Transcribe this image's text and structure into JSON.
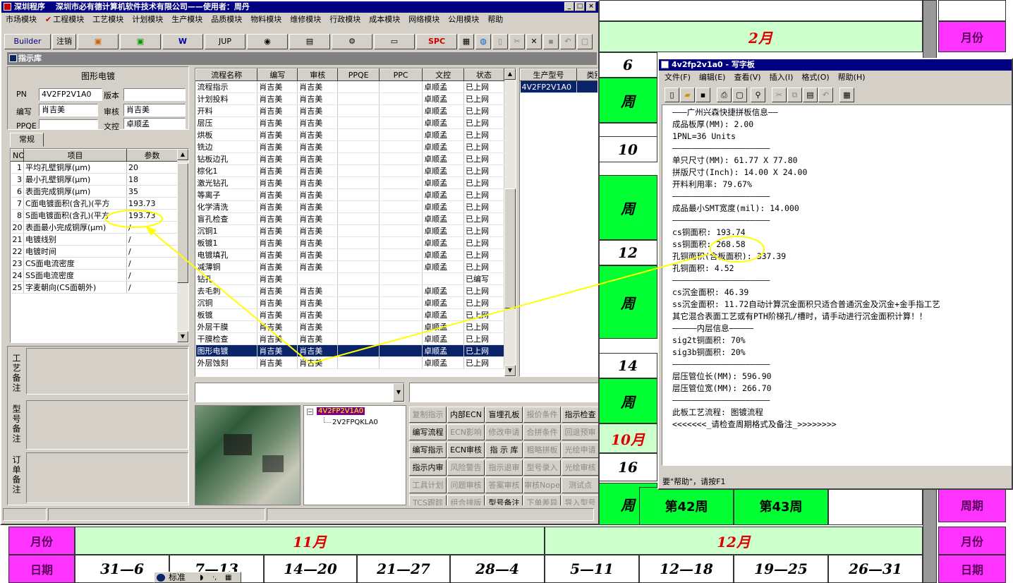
{
  "background_calendar": {
    "colors": {
      "green": "#00ff33",
      "magenta": "#ff33ff",
      "light_green": "#ccffcc",
      "red_text": "#e00000"
    },
    "top_month": "2月",
    "side_label_month": "月份",
    "side_label_period": "周期",
    "side_label_date": "日期",
    "left_numbers": [
      "6",
      "10",
      "12",
      "14",
      "16"
    ],
    "left_weeks": [
      "周",
      "周",
      "周",
      "周",
      "周"
    ],
    "month_10": "10月",
    "week_42": "第42周",
    "week_43": "第43周",
    "bottom_month_label": "月份",
    "bottom_date_label": "日期",
    "month_11": "11月",
    "month_12": "12月",
    "date_ranges": [
      "31—6",
      "7—13",
      "14—20",
      "21—27",
      "28—4",
      "5—11",
      "12—18",
      "19—25",
      "26—31"
    ]
  },
  "main_window": {
    "title": "深圳程序　 深圳市必有德计算机软件技术有限公司——使用者：周丹",
    "menu": [
      "市场模块",
      "工程模块",
      "工艺模块",
      "计划模块",
      "生产模块",
      "品质模块",
      "物料模块",
      "维修模块",
      "行政模块",
      "成本模块",
      "网络模块",
      "公用模块",
      "帮助"
    ],
    "toolbar": {
      "builder": "Builder",
      "logout": "注销",
      "jup": "JUP",
      "spc": "SPC"
    },
    "subtitle": "指示库",
    "form": {
      "heading": "图形电镀",
      "pn_label": "PN",
      "pn_value": "4V2FP2V1A0",
      "version_label": "版本",
      "version_value": "",
      "writer_label": "编写",
      "writer_value": "肖吉美",
      "audit_label": "审核",
      "audit_value": "肖吉美",
      "ppqe_label": "PPQE",
      "ppqe_value": "",
      "control_label": "文控",
      "control_value": "卓顺孟",
      "tab_general": "常规"
    },
    "param_table": {
      "headers": [
        "NO",
        "项目",
        "参数"
      ],
      "rows": [
        [
          "1",
          "平均孔壁铜厚(μm)",
          "20"
        ],
        [
          "3",
          "最小孔壁铜厚(μm)",
          "18"
        ],
        [
          "6",
          "表面完成铜厚(μm)",
          "35"
        ],
        [
          "7",
          "C面电镀面积(含孔)(平方",
          "193.73"
        ],
        [
          "8",
          "S面电镀面积(含孔)(平方",
          "193.73"
        ],
        [
          "20",
          "表面最小完成铜厚(μm)",
          "/"
        ],
        [
          "21",
          "电镀线别",
          "/"
        ],
        [
          "22",
          "电镀时间",
          "/"
        ],
        [
          "23",
          "CS面电流密度",
          "/"
        ],
        [
          "24",
          "SS面电流密度",
          "/"
        ],
        [
          "25",
          "字麦朝向(CS面朝外)",
          "/"
        ]
      ]
    },
    "remarks": {
      "process": "工艺备注",
      "model": "型号备注",
      "order": "订单备注"
    },
    "process_table": {
      "headers": [
        "流程名称",
        "编写",
        "审核",
        "PPQE",
        "PPC",
        "文控",
        "状态"
      ],
      "rows": [
        [
          "流程指示",
          "肖吉美",
          "肖吉美",
          "",
          "",
          "卓顺孟",
          "已上网"
        ],
        [
          "计划投料",
          "肖吉美",
          "肖吉美",
          "",
          "",
          "卓顺孟",
          "已上网"
        ],
        [
          "开料",
          "肖吉美",
          "肖吉美",
          "",
          "",
          "卓顺孟",
          "已上网"
        ],
        [
          "层压",
          "肖吉美",
          "肖吉美",
          "",
          "",
          "卓顺孟",
          "已上网"
        ],
        [
          "烘板",
          "肖吉美",
          "肖吉美",
          "",
          "",
          "卓顺孟",
          "已上网"
        ],
        [
          "铣边",
          "肖吉美",
          "肖吉美",
          "",
          "",
          "卓顺孟",
          "已上网"
        ],
        [
          "钻板边孔",
          "肖吉美",
          "肖吉美",
          "",
          "",
          "卓顺孟",
          "已上网"
        ],
        [
          "棕化1",
          "肖吉美",
          "肖吉美",
          "",
          "",
          "卓顺孟",
          "已上网"
        ],
        [
          "激光钻孔",
          "肖吉美",
          "肖吉美",
          "",
          "",
          "卓顺孟",
          "已上网"
        ],
        [
          "等离子",
          "肖吉美",
          "肖吉美",
          "",
          "",
          "卓顺孟",
          "已上网"
        ],
        [
          "化学清洗",
          "肖吉美",
          "肖吉美",
          "",
          "",
          "卓顺孟",
          "已上网"
        ],
        [
          "盲孔检查",
          "肖吉美",
          "肖吉美",
          "",
          "",
          "卓顺孟",
          "已上网"
        ],
        [
          "沉铜1",
          "肖吉美",
          "肖吉美",
          "",
          "",
          "卓顺孟",
          "已上网"
        ],
        [
          "板镀1",
          "肖吉美",
          "肖吉美",
          "",
          "",
          "卓顺孟",
          "已上网"
        ],
        [
          "电镀填孔",
          "肖吉美",
          "肖吉美",
          "",
          "",
          "卓顺孟",
          "已上网"
        ],
        [
          "减薄铜",
          "肖吉美",
          "肖吉美",
          "",
          "",
          "卓顺孟",
          "已上网"
        ],
        [
          "钻孔",
          "肖吉美",
          "",
          "",
          "",
          "",
          "已编写"
        ],
        [
          "去毛刺",
          "肖吉美",
          "肖吉美",
          "",
          "",
          "卓顺孟",
          "已上网"
        ],
        [
          "沉铜",
          "肖吉美",
          "肖吉美",
          "",
          "",
          "卓顺孟",
          "已上网"
        ],
        [
          "板镀",
          "肖吉美",
          "肖吉美",
          "",
          "",
          "卓顺孟",
          "已上网"
        ],
        [
          "外层干膜",
          "肖吉美",
          "肖吉美",
          "",
          "",
          "卓顺孟",
          "已上网"
        ],
        [
          "干膜检查",
          "肖吉美",
          "肖吉美",
          "",
          "",
          "卓顺孟",
          "已上网"
        ],
        [
          "图形电镀",
          "肖吉美",
          "肖吉美",
          "",
          "",
          "卓顺孟",
          "已上网"
        ],
        [
          "外层蚀刻",
          "肖吉美",
          "肖吉美",
          "",
          "",
          "卓顺孟",
          "已上网"
        ]
      ],
      "selected_row": 22
    },
    "product_table": {
      "headers": [
        "生产型号",
        "类别"
      ],
      "rows": [
        [
          "4V2FP2V1A0",
          ""
        ]
      ]
    },
    "tree": {
      "root": "4V2FP2V1A0",
      "child": "2V2FPQKLA0"
    },
    "action_buttons": [
      [
        "复制指示",
        "内部ECN",
        "盲埋孔板",
        "报价条件",
        "指示检查"
      ],
      [
        "编写流程",
        "ECN影响",
        "修改申请",
        "合拼条件",
        "回退预审"
      ],
      [
        "编写指示",
        "ECN审核",
        "指 示 库",
        "粗略拼板",
        "光绘申请"
      ],
      [
        "指示内审",
        "风险警告",
        "指示退审",
        "型号录入",
        "光绘审核"
      ],
      [
        "工具计划",
        "问题审核",
        "答案审核",
        "审核Nope",
        "测试点"
      ],
      [
        "TCS跟踪",
        "组合排版",
        "型号备注",
        "下单差异",
        "导入型号"
      ]
    ],
    "action_disabled": [
      [
        true,
        false,
        false,
        true,
        false
      ],
      [
        false,
        true,
        true,
        true,
        true
      ],
      [
        false,
        false,
        false,
        true,
        true
      ],
      [
        false,
        true,
        true,
        true,
        true
      ],
      [
        true,
        true,
        true,
        true,
        true
      ],
      [
        true,
        true,
        false,
        true,
        true
      ]
    ]
  },
  "wordpad": {
    "title": "4v2fp2v1a0 - 写字板",
    "menu": [
      "文件(F)",
      "编辑(E)",
      "查看(V)",
      "插入(I)",
      "格式(O)",
      "帮助(H)"
    ],
    "lines": [
      "———广州兴森快捷拼板信息——",
      "成品板厚(MM): 2.00",
      "1PNL=36 Units",
      "————————————————————",
      "单只尺寸(MM): 61.77 X 77.80",
      "拼版尺寸(Inch): 14.00 X 24.00",
      "开料利用率: 79.67%",
      "————————————————————",
      "成品最小SMT宽度(mil): 14.000",
      "————————————————————",
      "cs铜面积: 193.74",
      "ss铜面积: 268.58",
      "孔铜面积(含板面积): 337.39",
      "孔铜面积: 4.52",
      "————————————————————",
      "cs沉金面积: 46.39",
      "ss沉金面积: 11.72自动计算沉金面积只适合普通沉金及沉金+金手指工艺",
      "其它混合表面工艺或有PTH阶梯孔/槽时，请手动进行沉金面积计算！！",
      "—————内层信息—————",
      "sig2t铜面积: 70%",
      "sig3b铜面积: 20%",
      "————————————————————",
      "层压管位长(MM): 596.90",
      "层压管位宽(MM): 266.70",
      "————————————————————",
      "此板工艺流程: 图镀流程",
      "<<<<<<<_请检查周期格式及备注_>>>>>>>>"
    ],
    "status": "要\"帮助\"，请按F1"
  },
  "taskbar": {
    "ime": "标准"
  },
  "annotation_color": "#ffff00"
}
